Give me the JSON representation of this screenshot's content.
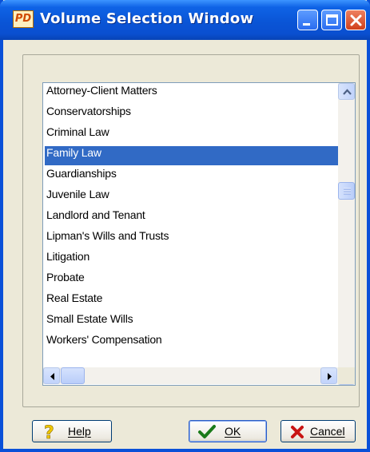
{
  "window": {
    "title": "Volume Selection Window",
    "app_icon_text": "PD"
  },
  "list": {
    "items": [
      "Attorney-Client Matters",
      "Conservatorships",
      "Criminal Law",
      "Family Law",
      "Guardianships",
      "Juvenile Law",
      "Landlord and Tenant",
      "Lipman's Wills and Trusts",
      "Litigation",
      "Probate",
      "Real Estate",
      "Small Estate Wills",
      "Workers' Compensation"
    ],
    "selected": "Family Law"
  },
  "buttons": {
    "help": "Help",
    "ok": "OK",
    "cancel": "Cancel"
  },
  "colors": {
    "titlebar": "#0a55d6",
    "selection": "#316ac5",
    "dialog_bg": "#ece9d8"
  }
}
